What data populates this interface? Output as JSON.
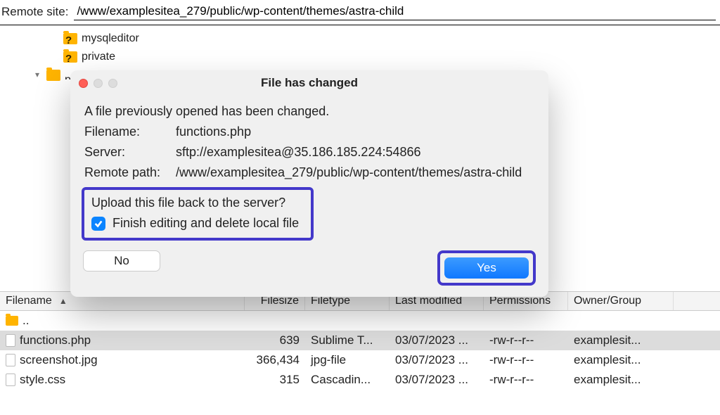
{
  "remote_bar": {
    "label": "Remote site:",
    "path": "/www/examplesitea_279/public/wp-content/themes/astra-child"
  },
  "tree": {
    "items": [
      {
        "toggle": "",
        "name": "mysqleditor",
        "glyph": "?"
      },
      {
        "toggle": "",
        "name": "private",
        "glyph": "?"
      },
      {
        "toggle": "▾",
        "name": "public",
        "glyph": "",
        "truncated": true
      }
    ]
  },
  "file_header": {
    "name": "Filename",
    "size": "Filesize",
    "type": "Filetype",
    "mod": "Last modified",
    "perm": "Permissions",
    "own": "Owner/Group"
  },
  "files": [
    {
      "name": "..",
      "size": "",
      "type": "",
      "mod": "",
      "perm": "",
      "own": "",
      "dotdot": true
    },
    {
      "name": "functions.php",
      "size": "639",
      "type": "Sublime T...",
      "mod": "03/07/2023 ...",
      "perm": "-rw-r--r--",
      "own": "examplesit...",
      "selected": true
    },
    {
      "name": "screenshot.jpg",
      "size": "366,434",
      "type": "jpg-file",
      "mod": "03/07/2023 ...",
      "perm": "-rw-r--r--",
      "own": "examplesit..."
    },
    {
      "name": "style.css",
      "size": "315",
      "type": "Cascadin...",
      "mod": "03/07/2023 ...",
      "perm": "-rw-r--r--",
      "own": "examplesit..."
    }
  ],
  "dialog": {
    "title": "File has changed",
    "message": "A file previously opened has been changed.",
    "filename_label": "Filename:",
    "filename_value": "functions.php",
    "server_label": "Server:",
    "server_value": "sftp://examplesitea@35.186.185.224:54866",
    "remote_label": "Remote path:",
    "remote_value": "/www/examplesitea_279/public/wp-content/themes/astra-child",
    "upload_question": "Upload this file back to the server?",
    "finish_label": "Finish editing and delete local file",
    "finish_checked": true,
    "no": "No",
    "yes": "Yes"
  }
}
